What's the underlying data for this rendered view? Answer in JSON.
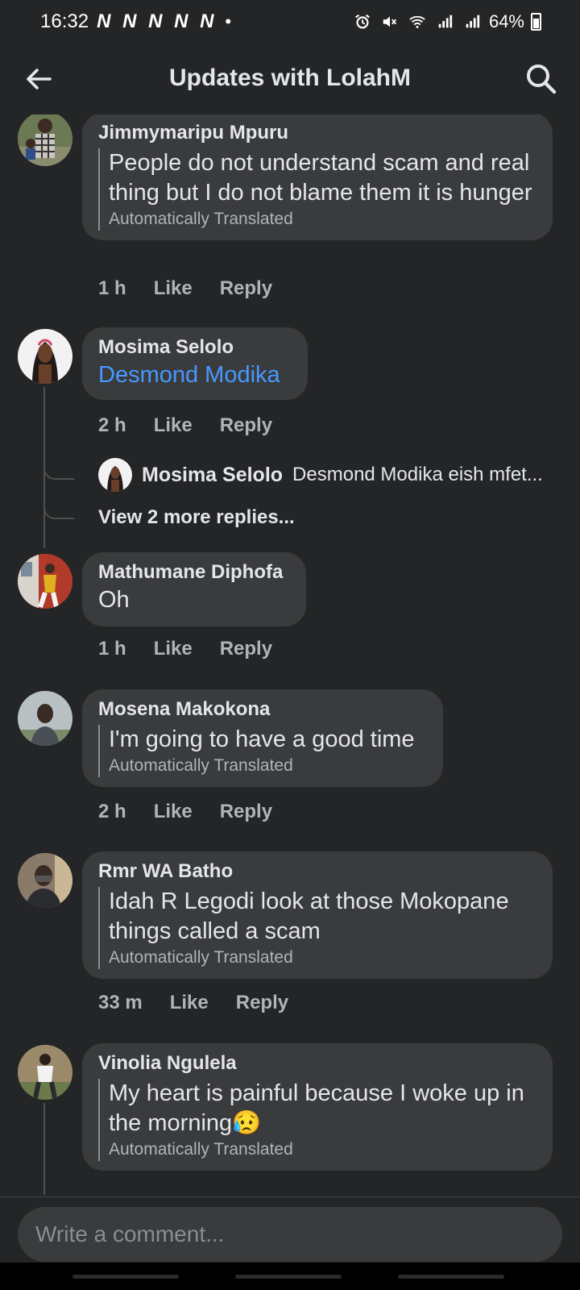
{
  "status_bar": {
    "time": "16:32",
    "notification_icons": "N N N N N",
    "dot": "•",
    "battery": "64%"
  },
  "header": {
    "title": "Updates with LolahM"
  },
  "comments": [
    {
      "author": "Jimmymaripu Mpuru",
      "text": "People do not understand scam and real thing but I do not blame them it is hunger",
      "translated_label": "Automatically Translated",
      "time": "1 h",
      "like": "Like",
      "reply": "Reply"
    },
    {
      "author": "Mosima Selolo",
      "mention": "Desmond Modika",
      "time": "2 h",
      "like": "Like",
      "reply": "Reply",
      "preview_reply": {
        "author": "Mosima Selolo",
        "text": "Desmond Modika eish mfet..."
      },
      "view_more": "View 2 more replies..."
    },
    {
      "author": "Mathumane Diphofa",
      "text": "Oh",
      "time": "1 h",
      "like": "Like",
      "reply": "Reply"
    },
    {
      "author": "Mosena Makokona",
      "text": "I'm going to have a good time",
      "translated_label": "Automatically Translated",
      "time": "2 h",
      "like": "Like",
      "reply": "Reply"
    },
    {
      "author": "Rmr WA Batho",
      "text": "Idah R Legodi look at those Mokopane things called a scam",
      "translated_label": "Automatically Translated",
      "time": "33 m",
      "like": "Like",
      "reply": "Reply"
    },
    {
      "author": "Vinolia Ngulela",
      "text": "My heart is painful because I woke up in the morning😥",
      "translated_label": "Automatically Translated"
    }
  ],
  "composer": {
    "placeholder": "Write a comment..."
  },
  "icons": {
    "back": "arrow-left-icon",
    "search": "search-icon"
  },
  "colors": {
    "background": "#242526",
    "bubble": "#3a3b3c",
    "mention": "#4599ff",
    "muted": "#b0b3b8"
  }
}
